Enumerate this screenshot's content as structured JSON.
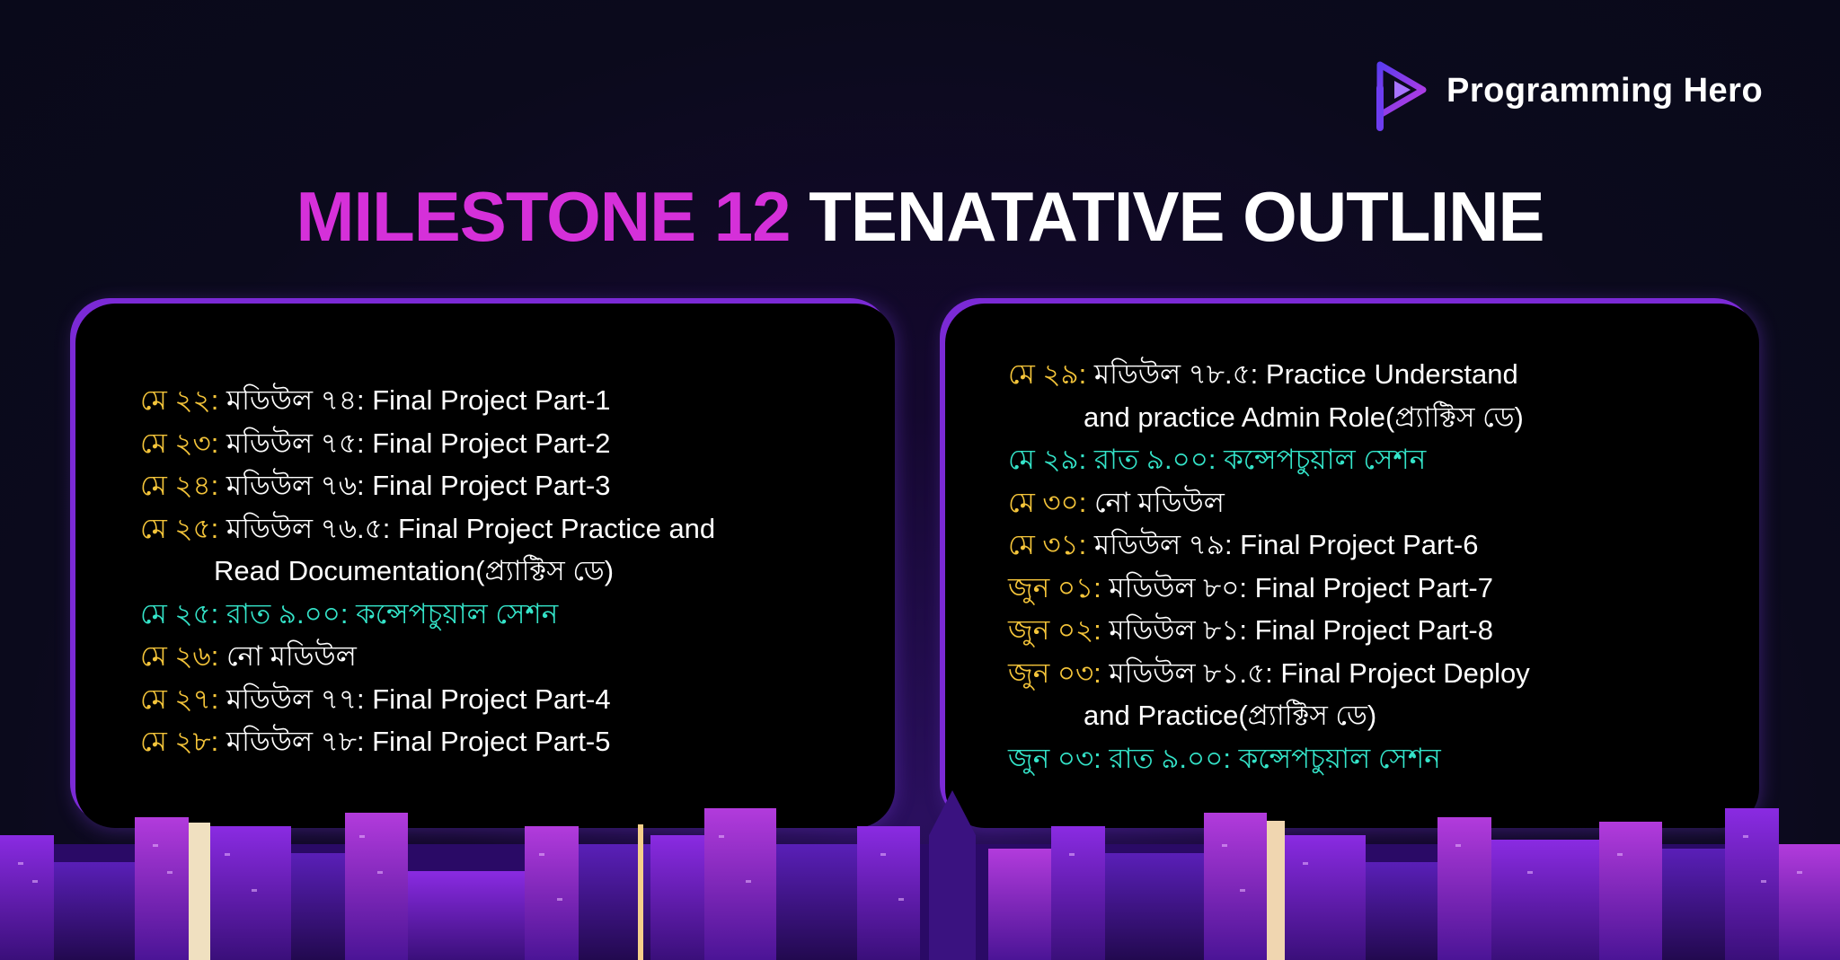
{
  "brand": {
    "name": "Programming Hero",
    "logo_icon": "play-triangle-icon",
    "colors": {
      "purple": "#7c3aed",
      "pink": "#d530d9"
    }
  },
  "title": {
    "accent": "MILESTONE 12",
    "main": "TENATATIVE OUTLINE"
  },
  "colors": {
    "date": "#f5c53a",
    "conceptual": "#34e4c9",
    "title_accent": "#d530d9",
    "card_border": "#7b2ad6"
  },
  "schedule_left": [
    {
      "date": "মে ২২:",
      "text": "মডিউল ৭৪: Final Project Part-1",
      "cont": ""
    },
    {
      "date": "মে ২৩:",
      "text": "মডিউল ৭৫: Final Project Part-2",
      "cont": ""
    },
    {
      "date": "মে ২৪:",
      "text": "মডিউল ৭৬: Final Project Part-3",
      "cont": ""
    },
    {
      "date": "মে ২৫:",
      "text": "মডিউল ৭৬.৫: Final Project Practice and",
      "cont": "Read Documentation(প্র্যাক্টিস ডে)"
    },
    {
      "date": "মে ২৫:",
      "text": "রাত ৯.০০: কন্সেপচুয়াল সেশন",
      "cont": ""
    },
    {
      "date": "মে ২৬:",
      "text": "নো মডিউল",
      "cont": ""
    },
    {
      "date": "মে ২৭:",
      "text": "মডিউল ৭৭: Final Project Part-4",
      "cont": ""
    },
    {
      "date": "মে ২৮:",
      "text": "মডিউল ৭৮: Final Project Part-5",
      "cont": ""
    }
  ],
  "schedule_right": [
    {
      "date": "মে ২৯:",
      "text": "মডিউল ৭৮.৫: Practice Understand",
      "cont": "and practice Admin Role(প্র্যাক্টিস ডে)"
    },
    {
      "date": "মে ২৯:",
      "text": "রাত ৯.০০: কন্সেপচুয়াল সেশন",
      "cont": ""
    },
    {
      "date": "মে ৩০:",
      "text": "নো মডিউল",
      "cont": ""
    },
    {
      "date": "মে ৩১:",
      "text": "মডিউল ৭৯:  Final Project Part-6",
      "cont": ""
    },
    {
      "date": "জুন ০১:",
      "text": "মডিউল ৮০: Final Project Part-7",
      "cont": ""
    },
    {
      "date": "জুন ০২:",
      "text": "মডিউল ৮১: Final Project Part-8",
      "cont": ""
    },
    {
      "date": "জুন ০৩:",
      "text": "মডিউল ৮১.৫: Final Project Deploy",
      "cont": "and Practice(প্র্যাক্টিস ডে)"
    },
    {
      "date": "জুন ০৩:",
      "text": "রাত ৯.০০: কন্সেপচুয়াল সেশন",
      "cont": ""
    }
  ]
}
